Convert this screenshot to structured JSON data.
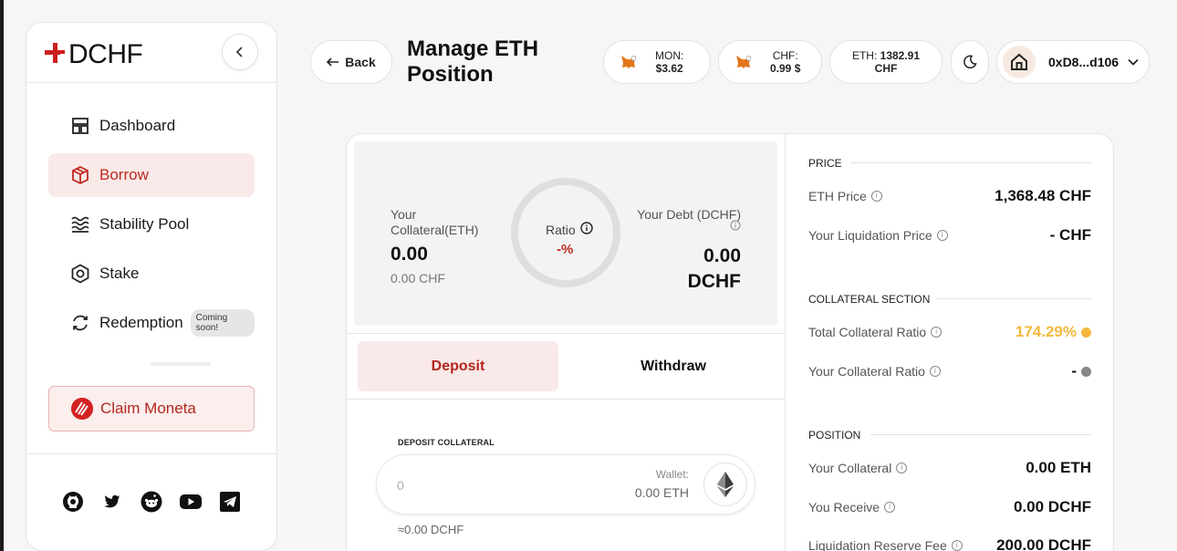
{
  "sidebar": {
    "logo": "DCHF",
    "nav": [
      {
        "label": "Dashboard",
        "icon": "dashboard-icon"
      },
      {
        "label": "Borrow",
        "icon": "box-icon",
        "active": true
      },
      {
        "label": "Stability Pool",
        "icon": "waves-icon"
      },
      {
        "label": "Stake",
        "icon": "hexagon-icon"
      },
      {
        "label": "Redemption",
        "icon": "refresh-icon",
        "badge": "Coming soon!"
      }
    ],
    "claim": "Claim Moneta",
    "socials": [
      "github-icon",
      "twitter-icon",
      "reddit-icon",
      "youtube-icon",
      "telegram-icon"
    ]
  },
  "header": {
    "back": "Back",
    "title": "Manage ETH Position",
    "mon_label": "MON:",
    "mon_value": "$3.62",
    "chf_label": "CHF:",
    "chf_value": "0.99 $",
    "eth_label": "ETH:",
    "eth_value": "1382.91",
    "eth_unit": "CHF",
    "address": "0xD8...d106"
  },
  "position": {
    "collateral_label": "Your Collateral(ETH)",
    "collateral_value": "0.00",
    "collateral_chf": "0.00 CHF",
    "ratio_label": "Ratio",
    "ratio_value": "-%",
    "debt_label": "Your Debt (DCHF)",
    "debt_value": "0.00",
    "debt_unit": "DCHF"
  },
  "tabs": {
    "deposit": "Deposit",
    "withdraw": "Withdraw"
  },
  "deposit_form": {
    "label": "DEPOSIT COLLATERAL",
    "placeholder": "0",
    "wallet_label": "Wallet:",
    "wallet_value": "0.00 ETH",
    "approx": "≈0.00 DCHF"
  },
  "details": {
    "price_head": "PRICE",
    "eth_price_label": "ETH Price",
    "eth_price_value": "1,368.48 CHF",
    "liq_price_label": "Your Liquidation Price",
    "liq_price_value": "- CHF",
    "collateral_head": "COLLATERAL SECTION",
    "tcr_label": "Total Collateral Ratio",
    "tcr_value": "174.29%",
    "tcr_color": "#f5b83d",
    "ycr_label": "Your Collateral Ratio",
    "ycr_value": "-",
    "ycr_color": "#888888",
    "position_head": "POSITION",
    "your_collateral_label": "Your Collateral",
    "your_collateral_value": "0.00 ETH",
    "receive_label": "You Receive",
    "receive_value": "0.00 DCHF",
    "reserve_label": "Liquidation Reserve Fee",
    "reserve_value": "200.00 DCHF"
  }
}
